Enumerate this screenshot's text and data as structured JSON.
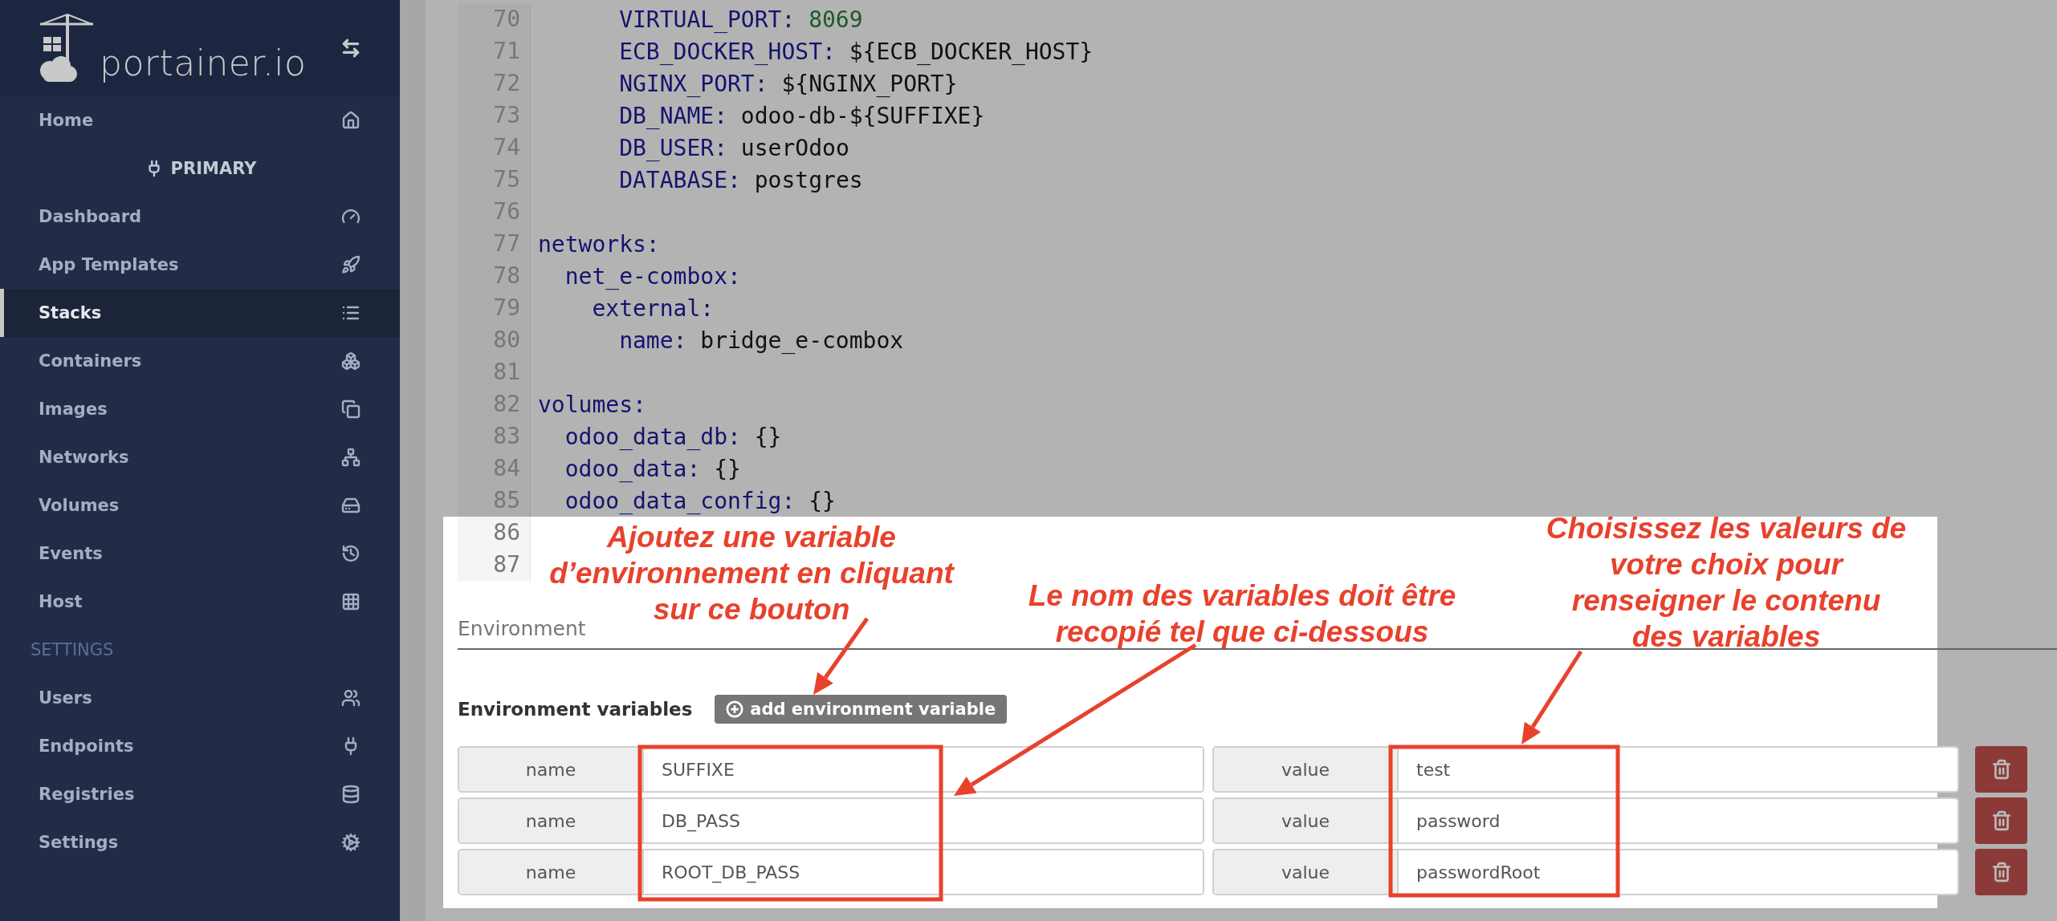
{
  "sidebar": {
    "logo": "portainer.io",
    "home": {
      "label": "Home",
      "selected": false
    },
    "endpoint": "PRIMARY",
    "endpoint_items": [
      {
        "label": "Dashboard",
        "selected": false
      },
      {
        "label": "App Templates",
        "selected": false
      },
      {
        "label": "Stacks",
        "selected": true
      },
      {
        "label": "Containers",
        "selected": false
      },
      {
        "label": "Images",
        "selected": false
      },
      {
        "label": "Networks",
        "selected": false
      },
      {
        "label": "Volumes",
        "selected": false
      },
      {
        "label": "Events",
        "selected": false
      },
      {
        "label": "Host",
        "selected": false
      }
    ],
    "settings_heading": "SETTINGS",
    "settings_items": [
      {
        "label": "Users",
        "selected": false
      },
      {
        "label": "Endpoints",
        "selected": false
      },
      {
        "label": "Registries",
        "selected": false
      },
      {
        "label": "Settings",
        "selected": false
      }
    ]
  },
  "editor": {
    "lines": [
      {
        "number": "70",
        "key": "      VIRTUAL_PORT:",
        "value": " 8069",
        "kind": "number"
      },
      {
        "number": "71",
        "key": "      ECB_DOCKER_HOST:",
        "value": " ${ECB_DOCKER_HOST}",
        "kind": "text"
      },
      {
        "number": "72",
        "key": "      NGINX_PORT:",
        "value": " ${NGINX_PORT}",
        "kind": "text"
      },
      {
        "number": "73",
        "key": "      DB_NAME:",
        "value": " odoo-db-${SUFFIXE}",
        "kind": "text"
      },
      {
        "number": "74",
        "key": "      DB_USER:",
        "value": " userOdoo",
        "kind": "text"
      },
      {
        "number": "75",
        "key": "      DATABASE:",
        "value": " postgres",
        "kind": "text"
      },
      {
        "number": "76"
      },
      {
        "number": "77",
        "key": "networks:"
      },
      {
        "number": "78",
        "key": "  net_e-combox:"
      },
      {
        "number": "79",
        "key": "    external:"
      },
      {
        "number": "80",
        "key": "      name:",
        "value": " bridge_e-combox",
        "kind": "text"
      },
      {
        "number": "81"
      },
      {
        "number": "82",
        "key": "volumes:"
      },
      {
        "number": "83",
        "key": "  odoo_data_db:",
        "value": " {}",
        "kind": "text"
      },
      {
        "number": "84",
        "key": "  odoo_data:",
        "value": " {}",
        "kind": "text"
      },
      {
        "number": "85",
        "key": "  odoo_data_config:",
        "value": " {}",
        "kind": "text"
      },
      {
        "number": "86"
      },
      {
        "number": "87"
      }
    ]
  },
  "environment": {
    "heading": "Environment",
    "variables_label": "Environment variables",
    "add_button": "add environment variable",
    "rows": [
      {
        "name_label": "name",
        "name": "SUFFIXE",
        "value_label": "value",
        "value": "test"
      },
      {
        "name_label": "name",
        "name": "DB_PASS",
        "value_label": "value",
        "value": "password"
      },
      {
        "name_label": "name",
        "name": "ROOT_DB_PASS",
        "value_label": "value",
        "value": "passwordRoot"
      }
    ]
  },
  "annotations": [
    {
      "text": "Ajoutez une variable\nd’environnement en cliquant\nsur ce bouton"
    },
    {
      "text": "Le nom des variables doit être\nrecopié tel que ci-dessous"
    },
    {
      "text": "Choisissez les valeurs de\nvotre choix pour\nrenseigner le contenu\ndes variables"
    }
  ]
}
